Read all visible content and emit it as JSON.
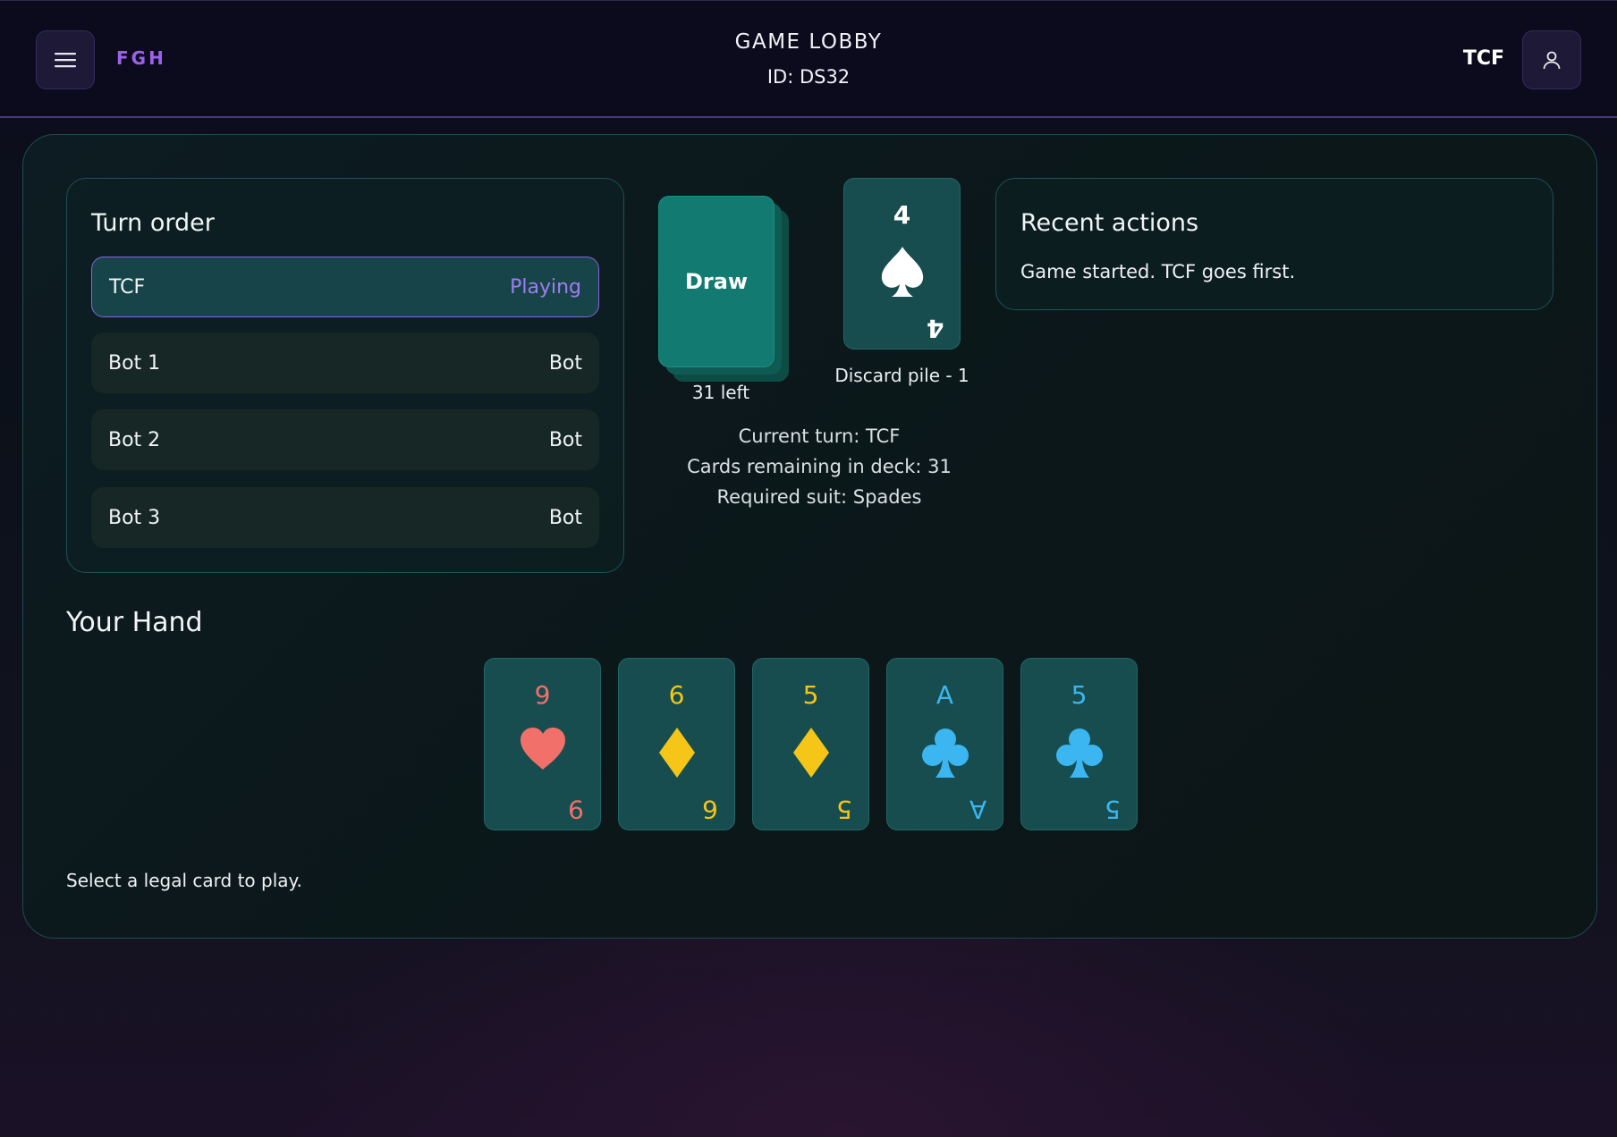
{
  "header": {
    "brand": "FGH",
    "title": "GAME LOBBY",
    "lobby_id": "ID: DS32",
    "username": "TCF",
    "menu_icon": "hamburger-menu-icon",
    "profile_icon": "user-icon"
  },
  "turn_order": {
    "title": "Turn order",
    "players": [
      {
        "name": "TCF",
        "role": "Playing"
      },
      {
        "name": "Bot 1",
        "role": "Bot"
      },
      {
        "name": "Bot 2",
        "role": "Bot"
      },
      {
        "name": "Bot 3",
        "role": "Bot"
      }
    ]
  },
  "deck": {
    "label": "Draw",
    "count_label": "31 left"
  },
  "discard": {
    "rank": "4",
    "suit": "spades",
    "color": "#ffffff",
    "label": "Discard pile - 1"
  },
  "status": {
    "current_turn": "Current turn: TCF",
    "cards_remaining": "Cards remaining in deck: 31",
    "required_suit": "Required suit: Spades"
  },
  "recent_actions": {
    "title": "Recent actions",
    "entries": [
      "Game started. TCF goes first."
    ]
  },
  "hand": {
    "title": "Your Hand",
    "cards": [
      {
        "rank": "9",
        "suit": "hearts",
        "color": "#f2706a"
      },
      {
        "rank": "6",
        "suit": "diamonds",
        "color": "#f5c518"
      },
      {
        "rank": "5",
        "suit": "diamonds",
        "color": "#f5c518"
      },
      {
        "rank": "A",
        "suit": "clubs",
        "color": "#3bb6f0"
      },
      {
        "rank": "5",
        "suit": "clubs",
        "color": "#3bb6f0"
      }
    ],
    "hint": "Select a legal card to play."
  }
}
